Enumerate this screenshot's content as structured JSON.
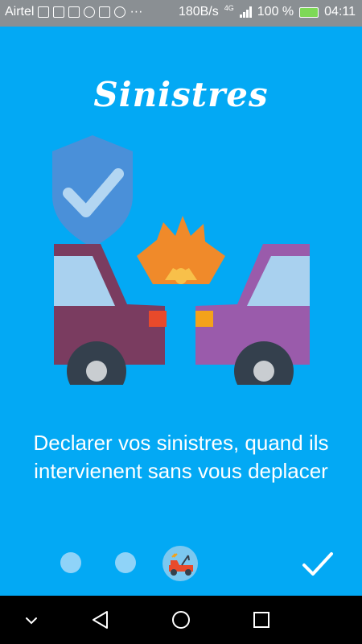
{
  "status_bar": {
    "carrier": "Airtel",
    "notifications_more": "···",
    "network_speed": "180B/s",
    "network_type": "4G",
    "battery_percent": "100 %",
    "time": "04:11",
    "icons": [
      "sim-icon",
      "car-icon",
      "walk-icon",
      "whatsapp-icon",
      "image-icon",
      "messenger-icon",
      "signal-icon",
      "battery-icon"
    ]
  },
  "onboarding": {
    "title": "Sinistres",
    "description": "Declarer vos sinistres, quand ils intervienent sans vous deplacer",
    "illustration": "car-crash-insurance-icon",
    "pages_total": 3,
    "current_page": 3,
    "done_icon": "check-icon"
  },
  "navigation_bar": {
    "buttons": [
      "collapse-icon",
      "back-icon",
      "home-icon",
      "recents-icon"
    ]
  },
  "colors": {
    "background": "#03A9F4",
    "status_bar": "#8a8f93",
    "dot_inactive": "#8fd3f8",
    "nav_bar": "#000000"
  }
}
